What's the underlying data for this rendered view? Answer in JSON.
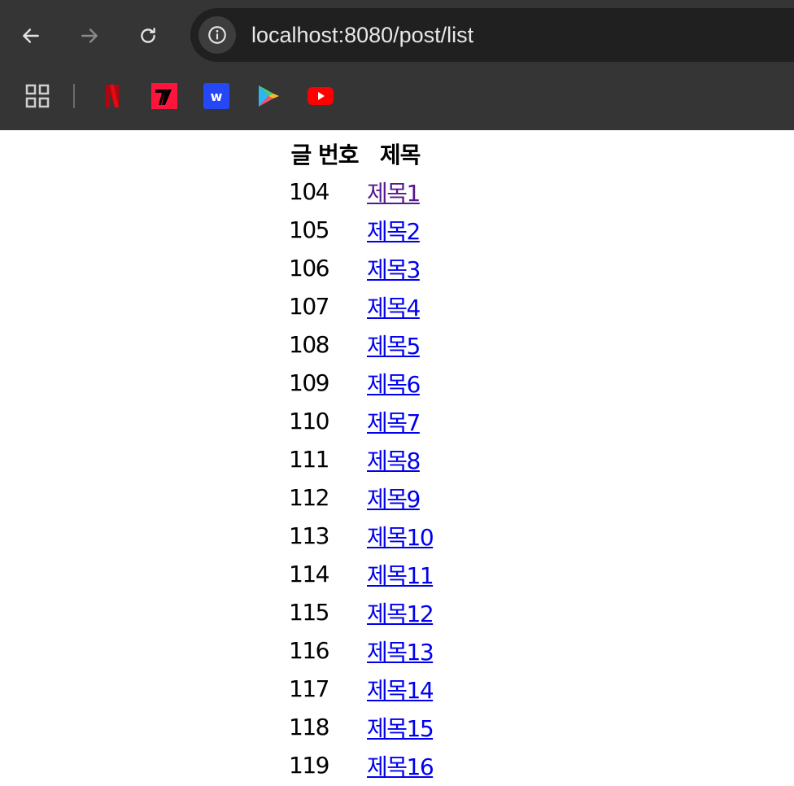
{
  "browser": {
    "url": "localhost:8080/post/list",
    "nav": {
      "back_icon": "arrow-left-icon",
      "forward_icon": "arrow-right-icon",
      "reload_icon": "reload-icon",
      "site_info_icon": "info-icon"
    },
    "bookmarks": [
      {
        "name": "apps-grid-icon"
      },
      {
        "name": "netflix-icon",
        "color": "#b1060f"
      },
      {
        "name": "tving-icon",
        "color": "#ff153c"
      },
      {
        "name": "watcha-icon",
        "color": "#2647f5"
      },
      {
        "name": "play-store-icon"
      },
      {
        "name": "youtube-icon",
        "color": "#ff0000"
      }
    ],
    "colors": {
      "chrome": "#353535",
      "omnibox": "#202020"
    }
  },
  "table": {
    "headers": {
      "number": "글 번호",
      "title": "제목"
    },
    "rows": [
      {
        "number": "104",
        "title": "제목1",
        "visited": true
      },
      {
        "number": "105",
        "title": "제목2"
      },
      {
        "number": "106",
        "title": "제목3"
      },
      {
        "number": "107",
        "title": "제목4"
      },
      {
        "number": "108",
        "title": "제목5"
      },
      {
        "number": "109",
        "title": "제목6"
      },
      {
        "number": "110",
        "title": "제목7"
      },
      {
        "number": "111",
        "title": "제목8"
      },
      {
        "number": "112",
        "title": "제목9"
      },
      {
        "number": "113",
        "title": "제목10"
      },
      {
        "number": "114",
        "title": "제목11"
      },
      {
        "number": "115",
        "title": "제목12"
      },
      {
        "number": "116",
        "title": "제목13"
      },
      {
        "number": "117",
        "title": "제목14"
      },
      {
        "number": "118",
        "title": "제목15"
      },
      {
        "number": "119",
        "title": "제목16"
      }
    ],
    "link_color": "#0000ee",
    "visited_color": "#551a8b"
  }
}
